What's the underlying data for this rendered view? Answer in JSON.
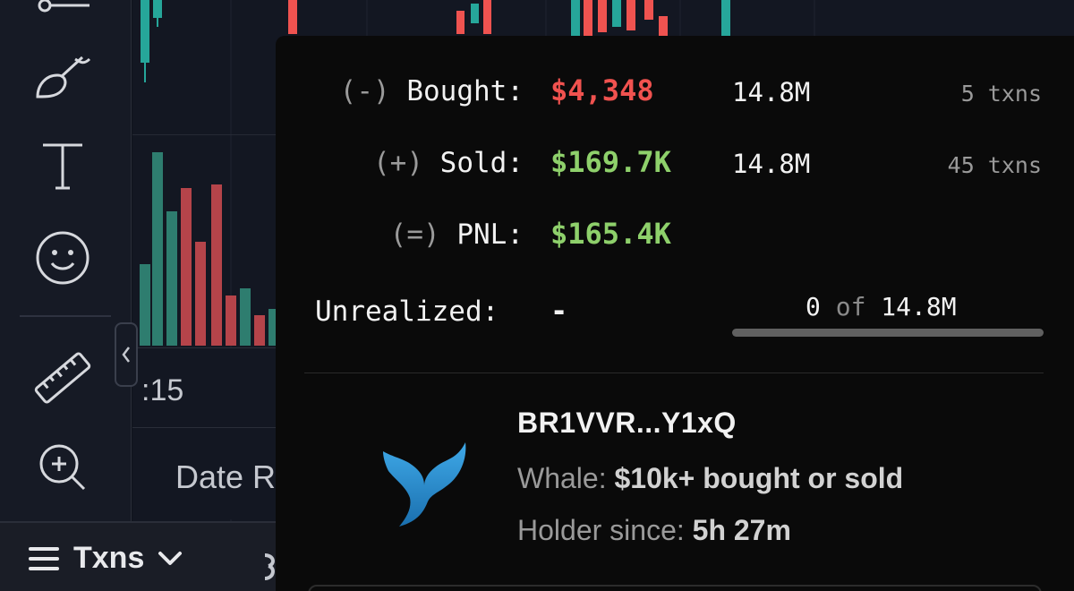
{
  "toolbar": {
    "tools": [
      {
        "icon": "horizontal-line-icon"
      },
      {
        "icon": "brush-icon"
      },
      {
        "icon": "text-icon"
      },
      {
        "icon": "emoji-icon"
      },
      {
        "icon": "ruler-icon"
      },
      {
        "icon": "zoom-in-icon"
      }
    ],
    "collapse_icon": "chevron-left-icon"
  },
  "chart": {
    "time_label": ":15",
    "date_range_label": "Date R"
  },
  "bottom_bar": {
    "txns_label": "Txns"
  },
  "popup": {
    "bought": {
      "sign": "(-)",
      "label": "Bought:",
      "value": "$4,348",
      "amount": "14.8M",
      "txns": "5 txns",
      "color": "#f0524f"
    },
    "sold": {
      "sign": "(+)",
      "label": "Sold:",
      "value": "$169.7K",
      "amount": "14.8M",
      "txns": "45 txns",
      "color": "#8ed06b"
    },
    "pnl": {
      "sign": "(=)",
      "label": "PNL:",
      "value": "$165.4K",
      "color": "#8ed06b"
    },
    "unrealized": {
      "label": "Unrealized:",
      "value": "-",
      "held": "0",
      "of": "of",
      "total": "14.8M",
      "held_fraction": 0
    }
  },
  "holder": {
    "address": "BR1VVR...Y1xQ",
    "whale_label": "Whale:",
    "whale_value": "$10k+ bought or sold",
    "since_label": "Holder since:",
    "since_value": "5h 27m",
    "icon": "whale-tail-icon"
  }
}
